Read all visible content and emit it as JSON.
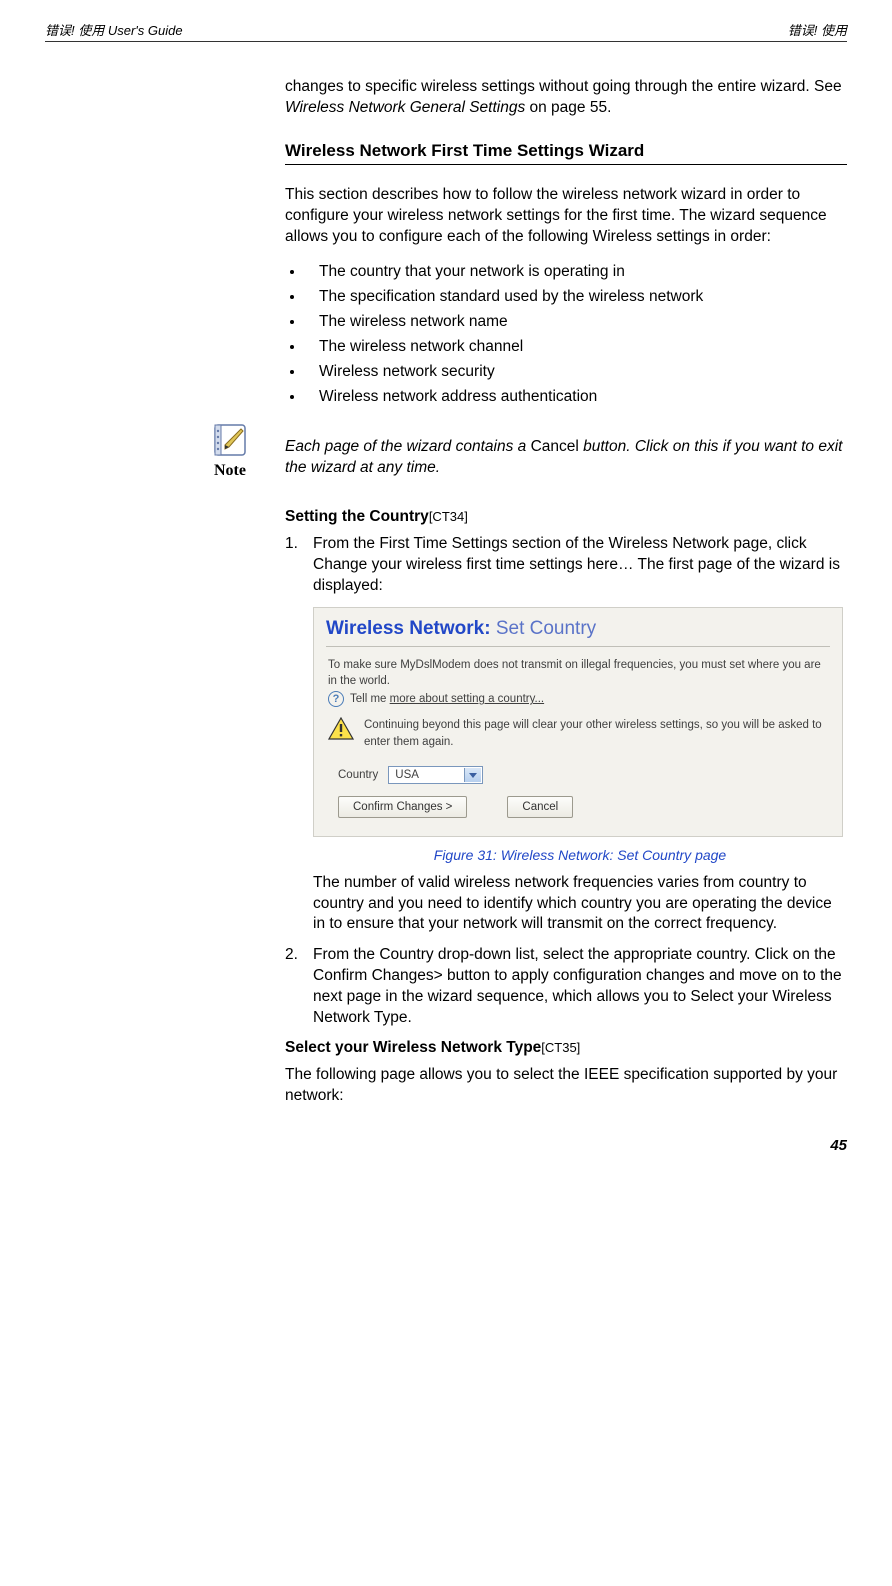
{
  "header": {
    "left_prefix": "错误! 使用",
    "left_suffix": " User's Guide",
    "right": "错误! 使用"
  },
  "intro_para": {
    "text_before": "changes to specific wireless settings without going through the entire wizard. See ",
    "italic": "Wireless Network General Settings",
    "text_after": " on page 55."
  },
  "section_heading": "Wireless Network First Time Settings Wizard",
  "section_intro": "This section describes how to follow the wireless network wizard in order to configure your wireless network settings for the first time. The wizard sequence allows you to configure each of the following Wireless settings in order:",
  "bullets": [
    "The country that your network is operating in",
    "The specification standard used by the wireless network",
    "The wireless network name",
    "The wireless network channel",
    "Wireless network security",
    "Wireless network address authentication"
  ],
  "note": {
    "label": "Note",
    "text_before": "Each page of the wizard contains a ",
    "noitalic": "Cancel",
    "text_after": " button. Click on this if you want to exit the wizard at any time."
  },
  "country_section": {
    "heading": "Setting the Country",
    "code": "[CT34]",
    "step1": {
      "num": "1.",
      "t1": "From the ",
      "i1": "First Time Settings",
      "t2": " section of the ",
      "i2": "Wireless Network",
      "t3": " page, click ",
      "i3": "Change your wireless first time settings here…",
      "t4": " The first page of the wizard is displayed:"
    }
  },
  "screenshot": {
    "title_bold": "Wireless Network:",
    "title_light": " Set Country",
    "line1": "To make sure MyDslModem does not transmit on illegal frequencies, you must set where you are in the world.",
    "help_prefix": "Tell me ",
    "help_link": "more about setting a country...",
    "warning": "Continuing beyond this page will clear your other wireless settings, so you will be asked to enter them again.",
    "country_label": "Country",
    "country_value": "USA",
    "confirm_button": "Confirm Changes >",
    "cancel_button": "Cancel"
  },
  "figure_caption": "Figure 31:       Wireless Network: Set Country page",
  "after_fig_para": "The number of valid wireless network frequencies varies from country to country and you need to identify which country you are operating the device in to ensure that your network will transmit on the correct frequency.",
  "step2": {
    "num": "2.",
    "t1": "From the ",
    "i1": "Country",
    "t2": " drop-down list, select the appropriate country. Click on the ",
    "i2": "Confirm Changes>",
    "t3": " button to apply configuration changes and move on to the next page in the wizard sequence, which allows you to ",
    "i3": "Select your Wireless Network Type",
    "t4": "."
  },
  "type_section": {
    "heading": "Select your Wireless Network Type",
    "code": "[CT35]",
    "para": "The following page allows you to select the IEEE specification supported by your network:"
  },
  "page_number": "45"
}
